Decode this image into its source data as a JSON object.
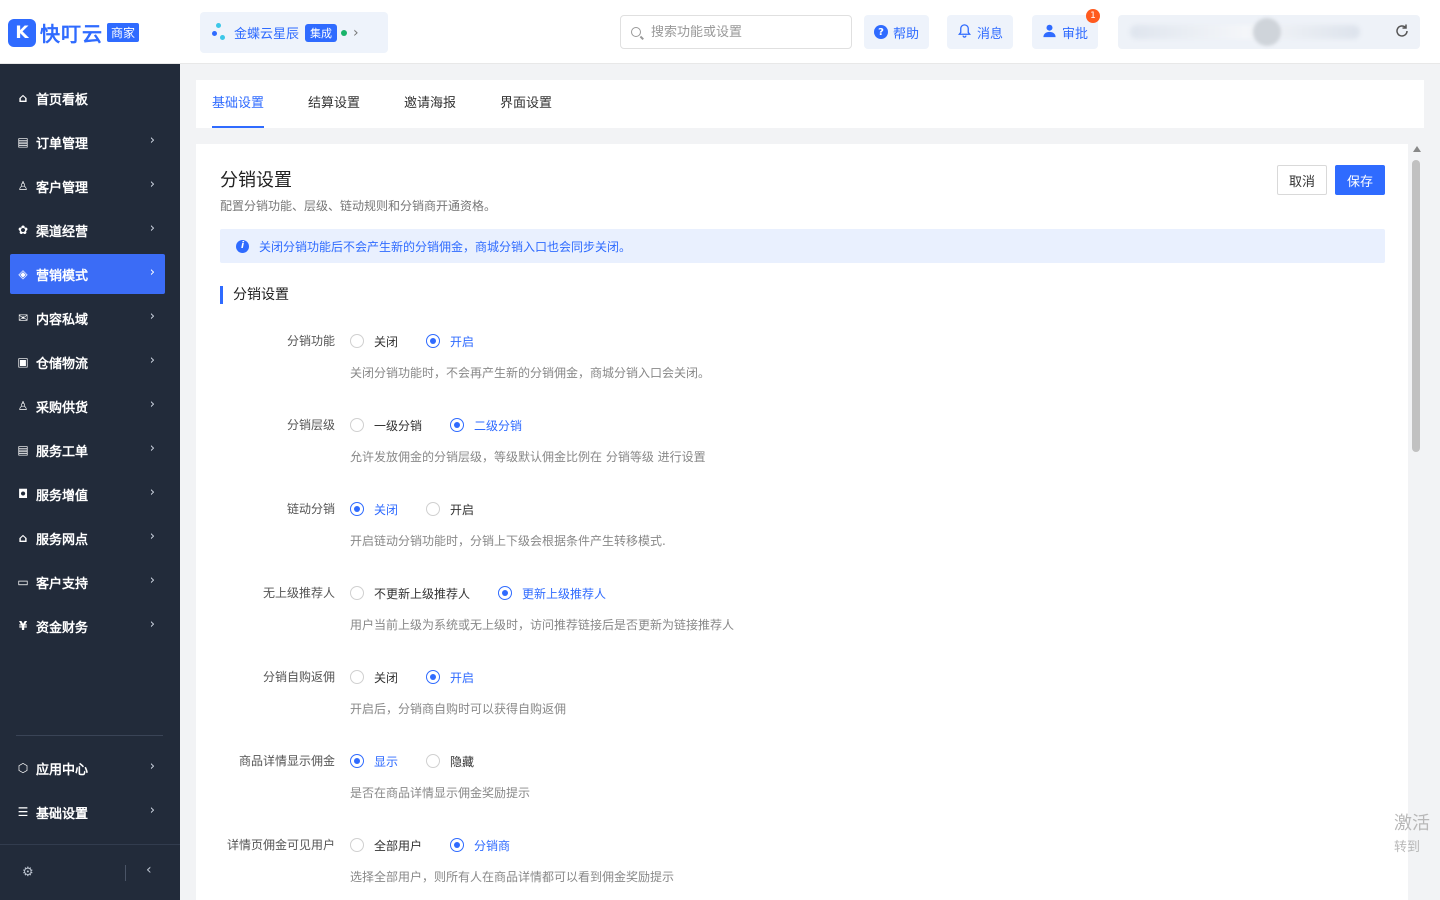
{
  "header": {
    "logo_mark": "K",
    "logo_text": "快叮云",
    "logo_tag": "商家",
    "app_name": "金蝶云星辰",
    "app_badge": "集成",
    "app_chevron": "›",
    "search_placeholder": "搜索功能或设置",
    "help_label": "帮助",
    "message_label": "消息",
    "approve_label": "审批",
    "approve_count": "1"
  },
  "sidebar": {
    "items": [
      {
        "label": "首页看板",
        "icon": "home-icon"
      },
      {
        "label": "订单管理",
        "icon": "order-icon"
      },
      {
        "label": "客户管理",
        "icon": "user-icon"
      },
      {
        "label": "渠道经营",
        "icon": "channel-icon"
      },
      {
        "label": "营销模式",
        "icon": "tag-icon"
      },
      {
        "label": "内容私域",
        "icon": "mail-icon"
      },
      {
        "label": "仓储物流",
        "icon": "box-icon"
      },
      {
        "label": "采购供货",
        "icon": "supplier-icon"
      },
      {
        "label": "服务工单",
        "icon": "ticket-icon"
      },
      {
        "label": "服务增值",
        "icon": "gift-icon"
      },
      {
        "label": "服务网点",
        "icon": "store-icon"
      },
      {
        "label": "客户支持",
        "icon": "support-icon"
      },
      {
        "label": "资金财务",
        "icon": "finance-icon"
      }
    ],
    "bottom_items": [
      {
        "label": "应用中心",
        "icon": "cube-icon"
      },
      {
        "label": "基础设置",
        "icon": "settings-list-icon"
      }
    ],
    "active_index": 4
  },
  "tabs": [
    "基础设置",
    "结算设置",
    "邀请海报",
    "界面设置"
  ],
  "panel": {
    "title": "分销设置",
    "subtitle": "配置分销功能、层级、链动规则和分销商开通资格。",
    "cancel_label": "取消",
    "save_label": "保存",
    "notice": "关闭分销功能后不会产生新的分销佣金，商城分销入口也会同步关闭。",
    "section_title": "分销设置"
  },
  "settings": [
    {
      "label": "分销功能",
      "options": [
        "关闭",
        "开启"
      ],
      "selected": 1,
      "hint": "关闭分销功能时，不会再产生新的分销佣金，商城分销入口会关闭。"
    },
    {
      "label": "分销层级",
      "options": [
        "一级分销",
        "二级分销"
      ],
      "selected": 1,
      "hint": "允许发放佣金的分销层级，等级默认佣金比例在 分销等级 进行设置"
    },
    {
      "label": "链动分销",
      "options": [
        "关闭",
        "开启"
      ],
      "selected": 0,
      "hint": "开启链动分销功能时，分销上下级会根据条件产生转移模式."
    },
    {
      "label": "无上级推荐人",
      "options": [
        "不更新上级推荐人",
        "更新上级推荐人"
      ],
      "selected": 1,
      "hint": "用户当前上级为系统或无上级时，访问推荐链接后是否更新为链接推荐人"
    },
    {
      "label": "分销自购返佣",
      "options": [
        "关闭",
        "开启"
      ],
      "selected": 1,
      "hint": "开启后，分销商自购时可以获得自购返佣"
    },
    {
      "label": "商品详情显示佣金",
      "options": [
        "显示",
        "隐藏"
      ],
      "selected": 0,
      "hint": "是否在商品详情显示佣金奖励提示"
    },
    {
      "label": "详情页佣金可见用户",
      "options": [
        "全部用户",
        "分销商"
      ],
      "selected": 1,
      "hint": "选择全部用户，则所有人在商品详情都可以看到佣金奖励提示"
    }
  ],
  "watermark": {
    "line1": "激活",
    "line2": "转到"
  },
  "colors": {
    "accent": "#2f6bff",
    "sidebar_bg": "#222b3a",
    "sidebar_active": "#3b6cf6",
    "notice_bg": "#e9f0fe"
  }
}
